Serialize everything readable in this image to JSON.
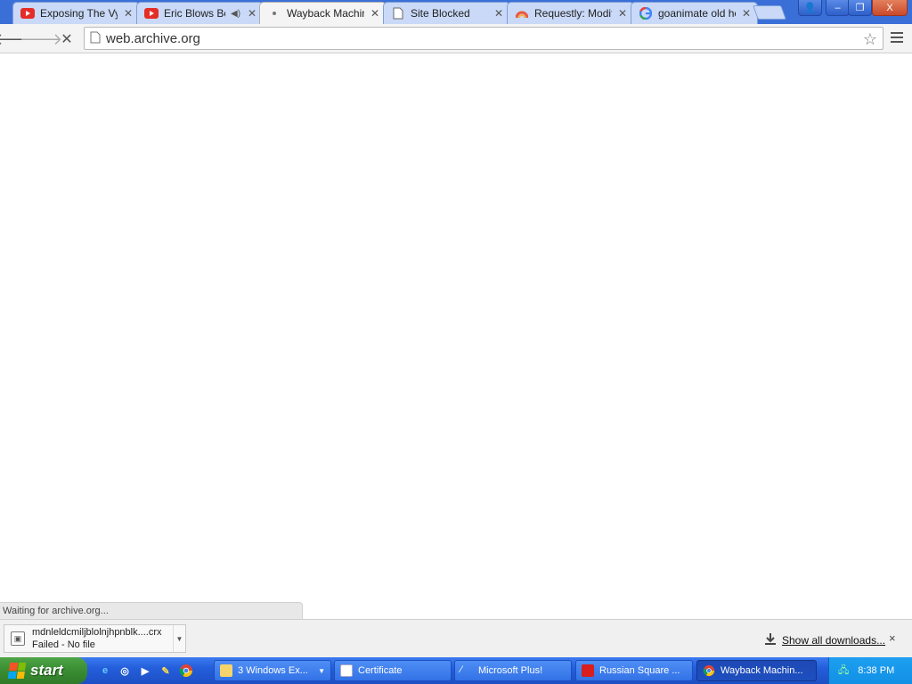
{
  "tabs": [
    {
      "title": "Exposing The Vy",
      "icon": "youtube-icon"
    },
    {
      "title": "Eric Blows Bo",
      "icon": "youtube-icon",
      "audio": true
    },
    {
      "title": "Wayback Machin",
      "icon": "loading-icon",
      "active": true
    },
    {
      "title": "Site Blocked",
      "icon": "page-icon"
    },
    {
      "title": "Requestly: Modify",
      "icon": "requestly-icon"
    },
    {
      "title": "goanimate old he",
      "icon": "google-icon"
    }
  ],
  "window_controls": {
    "profile": "👤",
    "minimize": "–",
    "restore": "❐",
    "close": "X"
  },
  "toolbar": {
    "back": "🡐",
    "forward": "🡒",
    "stop": "✕",
    "url": "web.archive.org",
    "star": "☆"
  },
  "status": {
    "text": "Waiting for archive.org..."
  },
  "download": {
    "filename": "mdnleldcmiljblolnjhpnblk....crx",
    "state": "Failed - No file",
    "show_all": "Show all downloads...",
    "close": "×"
  },
  "taskbar": {
    "start_label": "start",
    "quick_launch": [
      "ie-icon",
      "explorer-icon",
      "media-player-icon",
      "paint-icon",
      "chrome-icon"
    ],
    "tasks": [
      {
        "label": "3 Windows Ex...",
        "icon": "folder-icon"
      },
      {
        "label": "Certificate",
        "icon": "window-icon"
      },
      {
        "label": "Microsoft Plus!",
        "icon": "plus-icon"
      },
      {
        "label": "Russian Square ...",
        "icon": "game-icon"
      },
      {
        "label": "Wayback Machin...",
        "icon": "chrome-icon",
        "active": true
      }
    ],
    "clock": "8:38 PM"
  },
  "colors": {
    "taskbar": "#245edb",
    "start": "#3a8d32",
    "tabstrip": "#3a6fd8"
  }
}
